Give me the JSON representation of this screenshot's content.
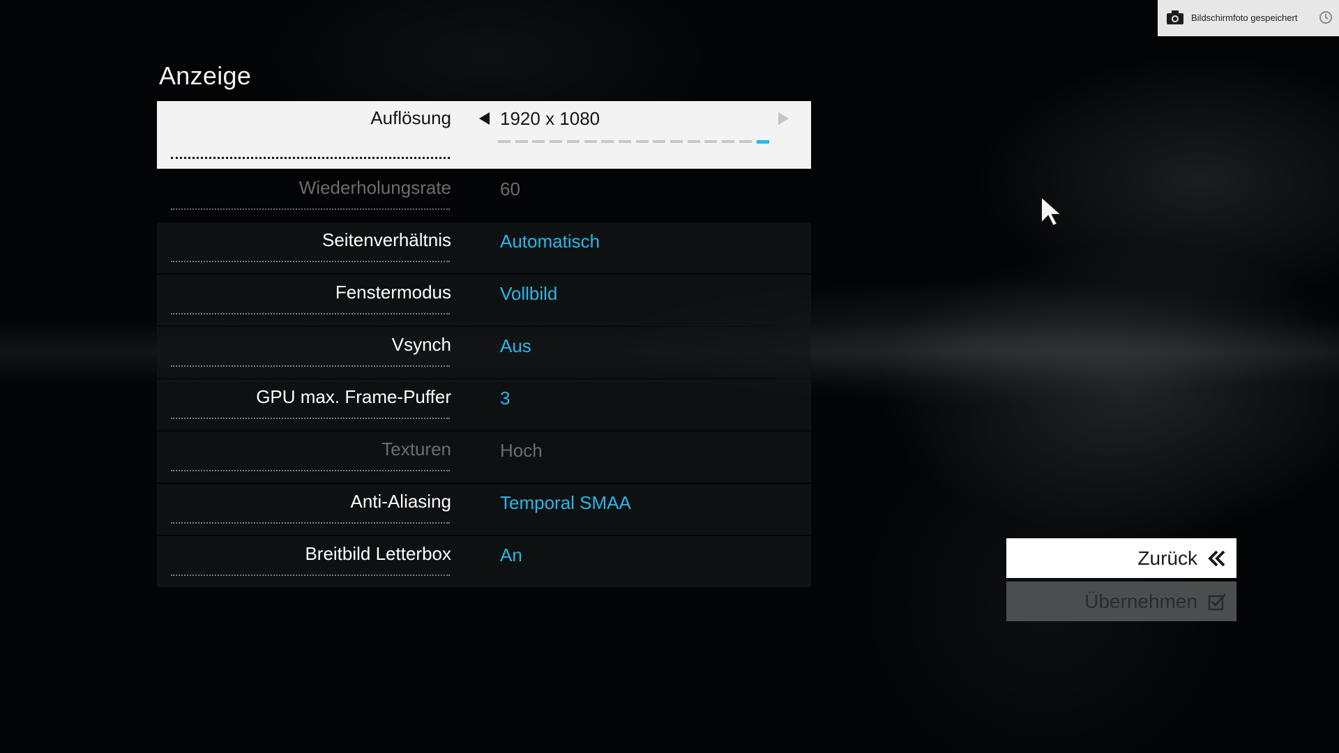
{
  "panel": {
    "title": "Anzeige"
  },
  "settings": {
    "resolution": {
      "label": "Auflösung",
      "value": "1920 x 1080",
      "option_count": 16,
      "selected_index": 15
    },
    "refresh_rate": {
      "label": "Wiederholungsrate",
      "value": "60"
    },
    "aspect_ratio": {
      "label": "Seitenverhältnis",
      "value": "Automatisch"
    },
    "window_mode": {
      "label": "Fenstermodus",
      "value": "Vollbild"
    },
    "vsync": {
      "label": "Vsynch",
      "value": "Aus"
    },
    "gpu_frame_buffer": {
      "label": "GPU max. Frame-Puffer",
      "value": "3"
    },
    "textures": {
      "label": "Texturen",
      "value": "Hoch"
    },
    "anti_aliasing": {
      "label": "Anti-Aliasing",
      "value": "Temporal SMAA"
    },
    "letterbox": {
      "label": "Breitbild Letterbox",
      "value": "An"
    }
  },
  "buttons": {
    "back_label": "Zurück",
    "apply_label": "Übernehmen"
  },
  "notification": {
    "text": "Bildschirmfoto gespeichert"
  },
  "colors": {
    "accent": "#27b8ea",
    "selected_row": "#f3f3f3",
    "disabled_text": "#6c6c6c"
  },
  "icons": {
    "left_arrow": "triangle-left-icon",
    "right_arrow": "triangle-right-icon",
    "back": "double-chevron-left-icon",
    "apply": "checkbox-check-icon",
    "camera": "camera-icon",
    "clock": "clock-icon",
    "cursor": "mouse-cursor-icon"
  }
}
